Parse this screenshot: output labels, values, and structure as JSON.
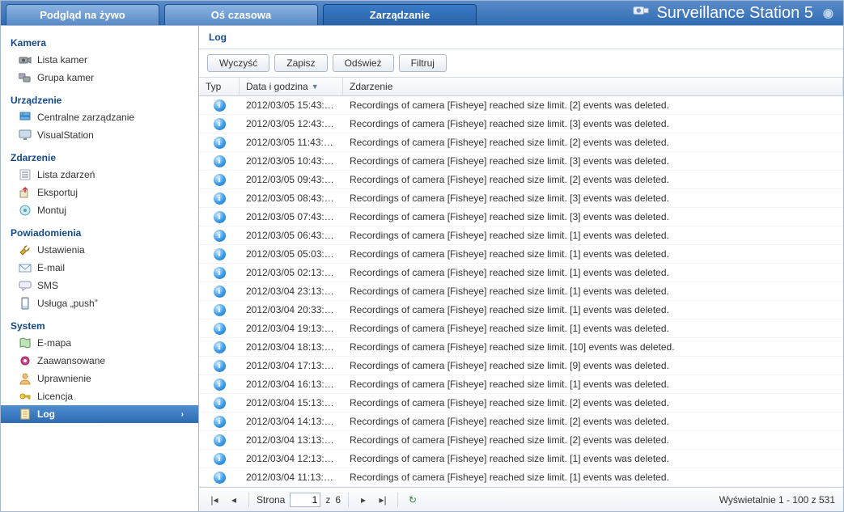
{
  "header": {
    "tabs": [
      {
        "label": "Podgląd na żywo",
        "active": false
      },
      {
        "label": "Oś czasowa",
        "active": false
      },
      {
        "label": "Zarządzanie",
        "active": true
      }
    ],
    "app_title": "Surveillance Station 5"
  },
  "sidebar": {
    "sections": [
      {
        "heading": "Kamera",
        "items": [
          {
            "label": "Lista kamer",
            "icon": "camera-icon"
          },
          {
            "label": "Grupa kamer",
            "icon": "camera-group-icon"
          }
        ]
      },
      {
        "heading": "Urządzenie",
        "items": [
          {
            "label": "Centralne zarządzanie",
            "icon": "server-icon"
          },
          {
            "label": "VisualStation",
            "icon": "monitor-icon"
          }
        ]
      },
      {
        "heading": "Zdarzenie",
        "items": [
          {
            "label": "Lista zdarzeń",
            "icon": "list-icon"
          },
          {
            "label": "Eksportuj",
            "icon": "export-icon"
          },
          {
            "label": "Montuj",
            "icon": "mount-icon"
          }
        ]
      },
      {
        "heading": "Powiadomienia",
        "items": [
          {
            "label": "Ustawienia",
            "icon": "wrench-icon"
          },
          {
            "label": "E-mail",
            "icon": "mail-icon"
          },
          {
            "label": "SMS",
            "icon": "sms-icon"
          },
          {
            "label": "Usługa „push”",
            "icon": "phone-icon"
          }
        ]
      },
      {
        "heading": "System",
        "items": [
          {
            "label": "E-mapa",
            "icon": "map-icon"
          },
          {
            "label": "Zaawansowane",
            "icon": "gear-icon"
          },
          {
            "label": "Uprawnienie",
            "icon": "user-icon"
          },
          {
            "label": "Licencja",
            "icon": "key-icon"
          },
          {
            "label": "Log",
            "icon": "log-icon",
            "selected": true
          }
        ]
      }
    ]
  },
  "main": {
    "title": "Log",
    "toolbar": {
      "clear": "Wyczyść",
      "save": "Zapisz",
      "refresh": "Odśwież",
      "filter": "Filtruj"
    },
    "columns": {
      "type": "Typ",
      "date": "Data i godzina",
      "event": "Zdarzenie"
    },
    "rows": [
      {
        "date": "2012/03/05 15:43:…",
        "event": "Recordings of camera [Fisheye] reached size limit. [2] events was deleted."
      },
      {
        "date": "2012/03/05 12:43:…",
        "event": "Recordings of camera [Fisheye] reached size limit. [3] events was deleted."
      },
      {
        "date": "2012/03/05 11:43:…",
        "event": "Recordings of camera [Fisheye] reached size limit. [2] events was deleted."
      },
      {
        "date": "2012/03/05 10:43:…",
        "event": "Recordings of camera [Fisheye] reached size limit. [3] events was deleted."
      },
      {
        "date": "2012/03/05 09:43:…",
        "event": "Recordings of camera [Fisheye] reached size limit. [2] events was deleted."
      },
      {
        "date": "2012/03/05 08:43:…",
        "event": "Recordings of camera [Fisheye] reached size limit. [3] events was deleted."
      },
      {
        "date": "2012/03/05 07:43:…",
        "event": "Recordings of camera [Fisheye] reached size limit. [3] events was deleted."
      },
      {
        "date": "2012/03/05 06:43:…",
        "event": "Recordings of camera [Fisheye] reached size limit. [1] events was deleted."
      },
      {
        "date": "2012/03/05 05:03:…",
        "event": "Recordings of camera [Fisheye] reached size limit. [1] events was deleted."
      },
      {
        "date": "2012/03/05 02:13:…",
        "event": "Recordings of camera [Fisheye] reached size limit. [1] events was deleted."
      },
      {
        "date": "2012/03/04 23:13:…",
        "event": "Recordings of camera [Fisheye] reached size limit. [1] events was deleted."
      },
      {
        "date": "2012/03/04 20:33:…",
        "event": "Recordings of camera [Fisheye] reached size limit. [1] events was deleted."
      },
      {
        "date": "2012/03/04 19:13:…",
        "event": "Recordings of camera [Fisheye] reached size limit. [1] events was deleted."
      },
      {
        "date": "2012/03/04 18:13:…",
        "event": "Recordings of camera [Fisheye] reached size limit. [10] events was deleted."
      },
      {
        "date": "2012/03/04 17:13:…",
        "event": "Recordings of camera [Fisheye] reached size limit. [9] events was deleted."
      },
      {
        "date": "2012/03/04 16:13:…",
        "event": "Recordings of camera [Fisheye] reached size limit. [1] events was deleted."
      },
      {
        "date": "2012/03/04 15:13:…",
        "event": "Recordings of camera [Fisheye] reached size limit. [2] events was deleted."
      },
      {
        "date": "2012/03/04 14:13:…",
        "event": "Recordings of camera [Fisheye] reached size limit. [2] events was deleted."
      },
      {
        "date": "2012/03/04 13:13:…",
        "event": "Recordings of camera [Fisheye] reached size limit. [2] events was deleted."
      },
      {
        "date": "2012/03/04 12:13:…",
        "event": "Recordings of camera [Fisheye] reached size limit. [1] events was deleted."
      },
      {
        "date": "2012/03/04 11:13:…",
        "event": "Recordings of camera [Fisheye] reached size limit. [1] events was deleted."
      }
    ],
    "pager": {
      "page_label": "Strona",
      "page_value": "1",
      "of_label": "z",
      "total_pages": "6",
      "display_text": "Wyświetalnie 1 - 100 z 531"
    }
  }
}
